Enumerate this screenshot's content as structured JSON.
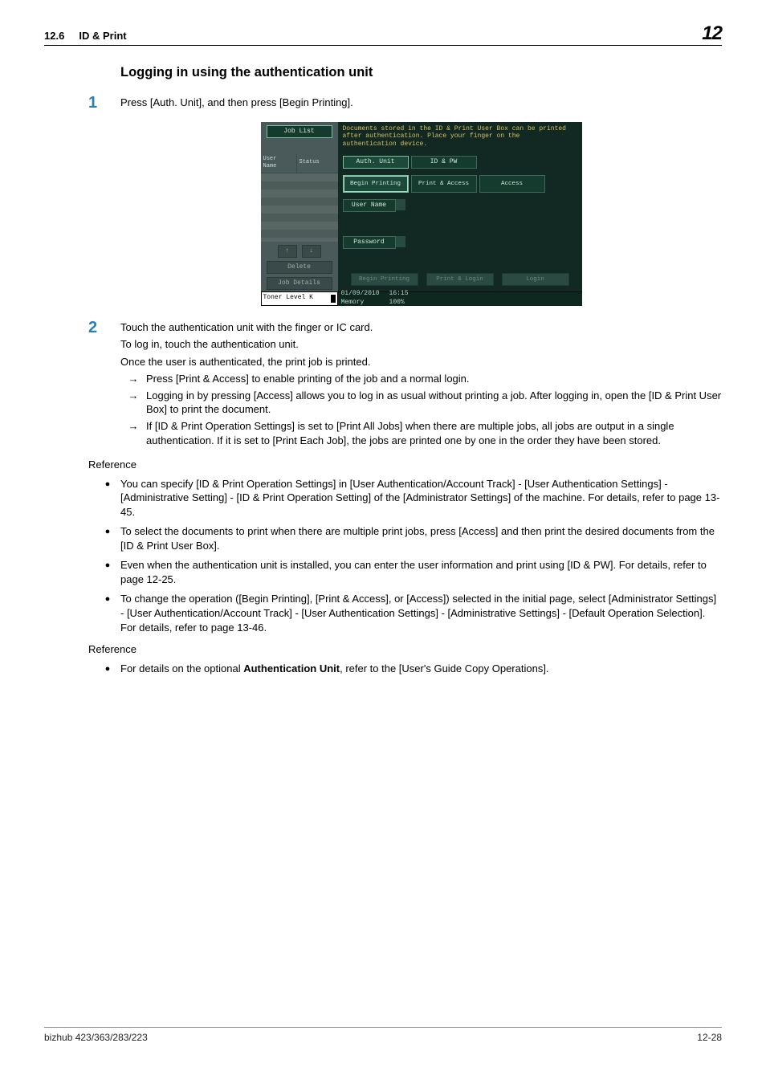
{
  "header": {
    "section_num": "12.6",
    "section_title": "ID & Print",
    "chapter": "12"
  },
  "heading": "Logging in using the authentication unit",
  "step1": {
    "num": "1",
    "text": "Press [Auth. Unit], and then press [Begin Printing]."
  },
  "screen": {
    "job_list": "Job List",
    "info": "Documents stored in the ID & Print User Box can be printed after authentication. Place your finger on the authentication device.",
    "tabs": {
      "auth": "Auth. Unit",
      "idpw": "ID & PW"
    },
    "modes": {
      "begin": "Begin Printing",
      "pa": "Print & Access",
      "access": "Access"
    },
    "user_name": "User Name",
    "password": "Password",
    "left_col": {
      "username_hdr": "User\nName",
      "status_hdr": "Status",
      "delete": "Delete",
      "job_details": "Job Details"
    },
    "arrows": {
      "up": "↑",
      "down": "↓"
    },
    "footer_btns": {
      "begin": "Begin Printing",
      "pl": "Print & Login",
      "login": "Login"
    },
    "status_bar": {
      "toner": "Toner Level",
      "k": "K",
      "date": "01/09/2010",
      "time": "16:15",
      "memory": "Memory",
      "mem_val": "100%"
    }
  },
  "step2": {
    "num": "2",
    "p1": "Touch the authentication unit with the finger or IC card.",
    "p2": "To log in, touch the authentication unit.",
    "p3": "Once the user is authenticated, the print job is printed.",
    "a1": "Press [Print & Access] to enable printing of the job and a normal login.",
    "a2": "Logging in by pressing [Access] allows you to log in as usual without printing a job. After logging in, open the [ID & Print User Box] to print the document.",
    "a3": "If [ID & Print Operation Settings] is set to [Print All Jobs] when there are multiple jobs, all jobs are output in a single authentication. If it is set to [Print Each Job], the jobs are printed one by one in the order they have been stored."
  },
  "ref1_label": "Reference",
  "ref1": {
    "b1": "You can specify [ID & Print Operation Settings] in [User Authentication/Account Track] - [User Authentication Settings] - [Administrative Setting] - [ID & Print Operation Setting] of the [Administrator Settings] of the machine. For details, refer to page 13-45.",
    "b2": "To select the documents to print when there are multiple print jobs, press [Access] and then print the desired documents from the [ID & Print User Box].",
    "b3": "Even when the authentication unit is installed, you can enter the user information and print using [ID & PW]. For details, refer to page 12-25.",
    "b4": "To change the operation ([Begin Printing], [Print & Access], or [Access]) selected in the initial page, select [Administrator Settings] - [User Authentication/Account Track] - [User Authentication Settings] - [Administrative Settings] - [Default Operation Selection]. For details, refer to page 13-46."
  },
  "ref2_label": "Reference",
  "ref2": {
    "b1_pre": "For details on the optional ",
    "b1_bold": "Authentication Unit",
    "b1_post": ", refer to the [User's Guide Copy Operations]."
  },
  "footer": {
    "model": "bizhub 423/363/283/223",
    "page": "12-28"
  },
  "arrow_sym": "→",
  "bullet_sym": "●"
}
